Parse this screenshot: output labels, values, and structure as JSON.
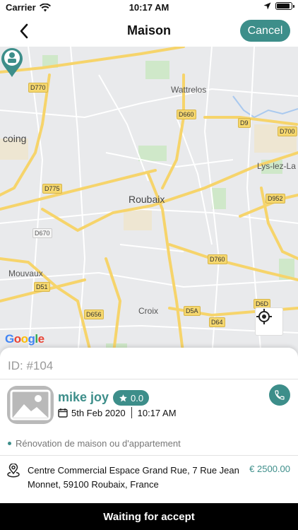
{
  "status_bar": {
    "carrier": "Carrier",
    "time": "10:17 AM",
    "battery_level": 0.9
  },
  "nav": {
    "title": "Maison",
    "cancel_label": "Cancel",
    "back_icon": "chevron-left-icon"
  },
  "map": {
    "places": {
      "wattrelos": "Wattrelos",
      "coing": "coing",
      "lys": "Lys-lez-La",
      "roubaix": "Roubaix",
      "mouvaux": "Mouvaux",
      "croix": "Croix"
    },
    "roads": {
      "d770": "D770",
      "d660": "D660",
      "d9": "D9",
      "d700": "D700",
      "d775": "D775",
      "d952": "D952",
      "d670": "D670",
      "d760": "D760",
      "d51": "D51",
      "d6d": "D6D",
      "d656": "D656",
      "d5a": "D5A",
      "d64": "D64"
    },
    "attribution": [
      "G",
      "o",
      "o",
      "g",
      "l",
      "e"
    ],
    "pin_icon": "map-pin-icon",
    "locate_icon": "crosshair-icon"
  },
  "job": {
    "id_label": "ID: #104",
    "user_name": "mike joy",
    "rating": "0.0",
    "date": "5th Feb 2020",
    "time": "10:17 AM",
    "service": "Rénovation de maison ou d'appartement",
    "address": "Centre Commercial Espace Grand Rue, 7 Rue Jean Monnet, 59100 Roubaix, France",
    "price": "€ 2500.00"
  },
  "footer": {
    "status": "Waiting for accept"
  },
  "colors": {
    "accent": "#3d8e8a",
    "bar": "#000000"
  }
}
